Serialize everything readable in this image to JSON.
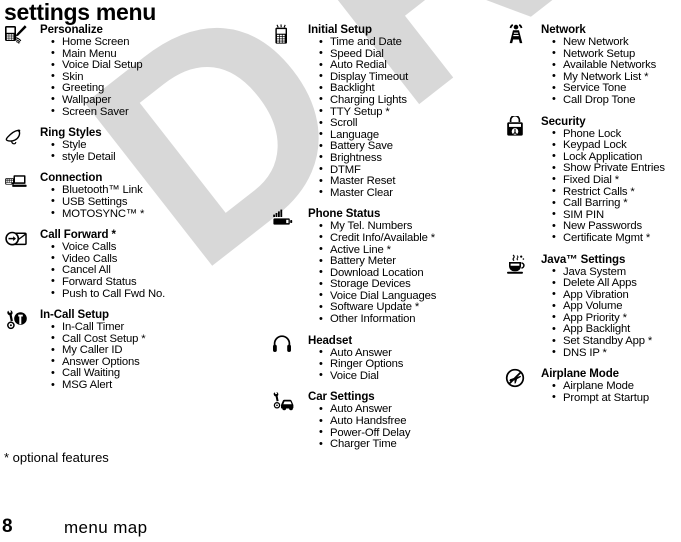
{
  "page": {
    "title": "settings menu",
    "footnote": "* optional features",
    "number": "8",
    "footer_label": "menu map",
    "watermark": "DRAFT",
    "watermark_color": "#d8d8d8"
  },
  "columns": [
    {
      "groups": [
        {
          "icon": "personalize-icon",
          "title": "Personalize",
          "items": [
            "Home Screen",
            "Main Menu",
            "Voice Dial Setup",
            "Skin",
            "Greeting",
            "Wallpaper",
            "Screen Saver"
          ]
        },
        {
          "icon": "ring-styles-bell-icon",
          "title": "Ring Styles",
          "items": [
            "Style",
            " style Detail"
          ]
        },
        {
          "icon": "connection-icon",
          "title": "Connection",
          "items": [
            "Bluetooth™ Link",
            "USB Settings",
            "MOTOSYNC™ *"
          ]
        },
        {
          "icon": "call-forward-icon",
          "title": "Call Forward *",
          "items": [
            "Voice Calls",
            "Video Calls",
            "Cancel All",
            "Forward Status",
            "Push to Call Fwd No."
          ]
        },
        {
          "icon": "in-call-setup-icon",
          "title": "In-Call Setup",
          "items": [
            "In-Call Timer",
            "Call Cost Setup *",
            "My Caller ID",
            "Answer Options",
            "Call Waiting",
            "MSG Alert"
          ]
        }
      ]
    },
    {
      "groups": [
        {
          "icon": "initial-setup-phone-icon",
          "title": "Initial Setup",
          "items": [
            "Time and Date",
            "Speed Dial",
            "Auto Redial",
            "Display Timeout",
            "Backlight",
            "Charging Lights",
            "TTY Setup *",
            "Scroll",
            "Language",
            "Battery Save",
            "Brightness",
            "DTMF",
            "Master Reset",
            "Master Clear"
          ]
        },
        {
          "icon": "phone-status-battery-icon",
          "title": "Phone Status",
          "items": [
            "My Tel. Numbers",
            "Credit Info/Available *",
            "Active Line *",
            "Battery Meter",
            "Download Location",
            "Storage Devices",
            "Voice Dial Languages",
            "Software Update *",
            "Other Information"
          ]
        },
        {
          "icon": "headset-icon",
          "title": "Headset",
          "items": [
            "Auto Answer",
            "Ringer Options",
            "Voice Dial"
          ]
        },
        {
          "icon": "car-settings-icon",
          "title": "Car Settings",
          "items": [
            "Auto Answer",
            "Auto Handsfree",
            "Power-Off Delay",
            "Charger Time"
          ]
        }
      ]
    },
    {
      "groups": [
        {
          "icon": "network-tower-icon",
          "title": "Network",
          "items": [
            "New Network",
            "Network Setup",
            "Available Networks",
            "My Network List *",
            "Service Tone",
            "Call Drop Tone"
          ]
        },
        {
          "icon": "security-padlock-icon",
          "title": "Security",
          "items": [
            "Phone Lock",
            "Keypad Lock",
            "Lock Application",
            "Show Private Entries",
            "Fixed Dial *",
            "Restrict Calls *",
            "Call Barring *",
            "SIM PIN",
            "New Passwords",
            "Certificate Mgmt *"
          ]
        },
        {
          "icon": "java-coffee-cup-icon",
          "title": "Java™ Settings",
          "items": [
            "Java System",
            "Delete All Apps",
            "App Vibration",
            "App Volume",
            "App Priority *",
            "App Backlight",
            "Set Standby App *",
            "DNS IP *"
          ]
        },
        {
          "icon": "airplane-mode-icon",
          "title": "Airplane Mode",
          "items": [
            "Airplane Mode",
            "Prompt at Startup"
          ]
        }
      ]
    }
  ]
}
